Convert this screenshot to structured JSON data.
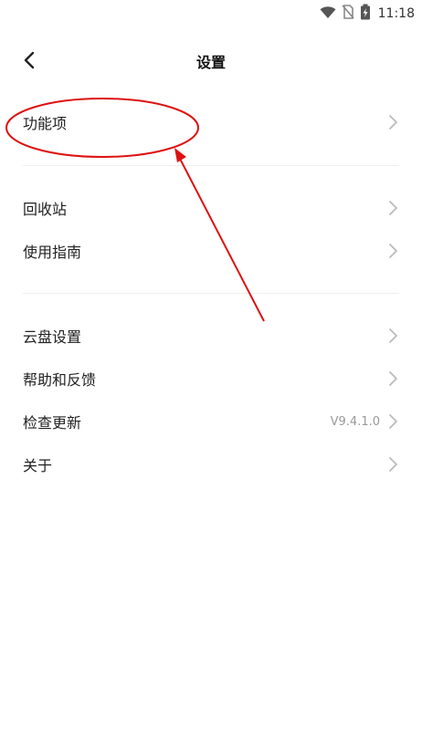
{
  "status_bar": {
    "time": "11:18",
    "icons": [
      "wifi-icon",
      "no-sim-icon",
      "battery-charging-icon"
    ]
  },
  "header": {
    "title": "设置",
    "back_icon": "chevron-left-icon"
  },
  "groups": [
    {
      "items": [
        {
          "label": "功能项"
        }
      ]
    },
    {
      "items": [
        {
          "label": "回收站"
        },
        {
          "label": "使用指南"
        }
      ]
    },
    {
      "items": [
        {
          "label": "云盘设置"
        },
        {
          "label": "帮助和反馈"
        },
        {
          "label": "检查更新",
          "value": "V9.4.1.0"
        },
        {
          "label": "关于"
        }
      ]
    }
  ],
  "annotation": {
    "color": "#dd1111",
    "shape": "ellipse-with-arrow"
  },
  "colors": {
    "background": "#ffffff",
    "text": "#222222",
    "muted": "#999999",
    "divider": "#efefef"
  }
}
